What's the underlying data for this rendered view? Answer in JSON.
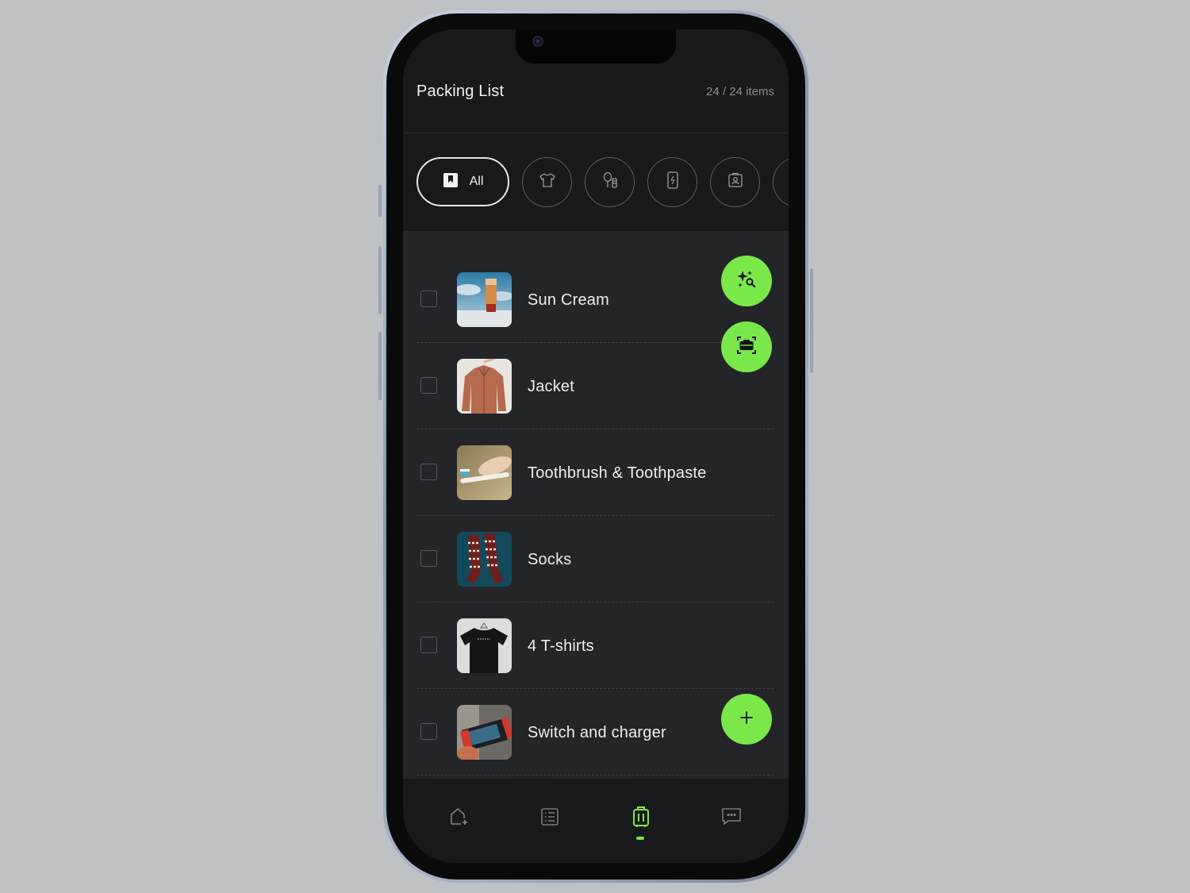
{
  "header": {
    "title": "Packing List",
    "count": "24 / 24 items"
  },
  "categories": {
    "all_label": "All",
    "items": [
      {
        "icon": "shirt-icon"
      },
      {
        "icon": "toiletries-icon"
      },
      {
        "icon": "phone-charging-icon"
      },
      {
        "icon": "id-card-icon"
      },
      {
        "icon": "more-category-icon"
      }
    ]
  },
  "items": [
    {
      "label": "Sun Cream",
      "checked": false,
      "image": "sun-cream-photo"
    },
    {
      "label": "Jacket",
      "checked": false,
      "image": "jacket-photo"
    },
    {
      "label": "Toothbrush & Toothpaste",
      "checked": false,
      "image": "toothbrush-photo"
    },
    {
      "label": "Socks",
      "checked": false,
      "image": "socks-photo"
    },
    {
      "label": "4 T-shirts",
      "checked": false,
      "image": "tshirt-photo"
    },
    {
      "label": "Switch and charger",
      "checked": false,
      "image": "switch-photo"
    }
  ],
  "actions": {
    "ai_search": "sparkle-search-icon",
    "scan_luggage": "scan-luggage-icon",
    "add": "plus-icon"
  },
  "nav": {
    "items": [
      {
        "icon": "home-icon",
        "active": false
      },
      {
        "icon": "list-icon",
        "active": false
      },
      {
        "icon": "luggage-icon",
        "active": true
      },
      {
        "icon": "chat-icon",
        "active": false
      }
    ]
  },
  "colors": {
    "accent": "#7be84a",
    "background": "#18191b",
    "list_background": "#242529"
  }
}
